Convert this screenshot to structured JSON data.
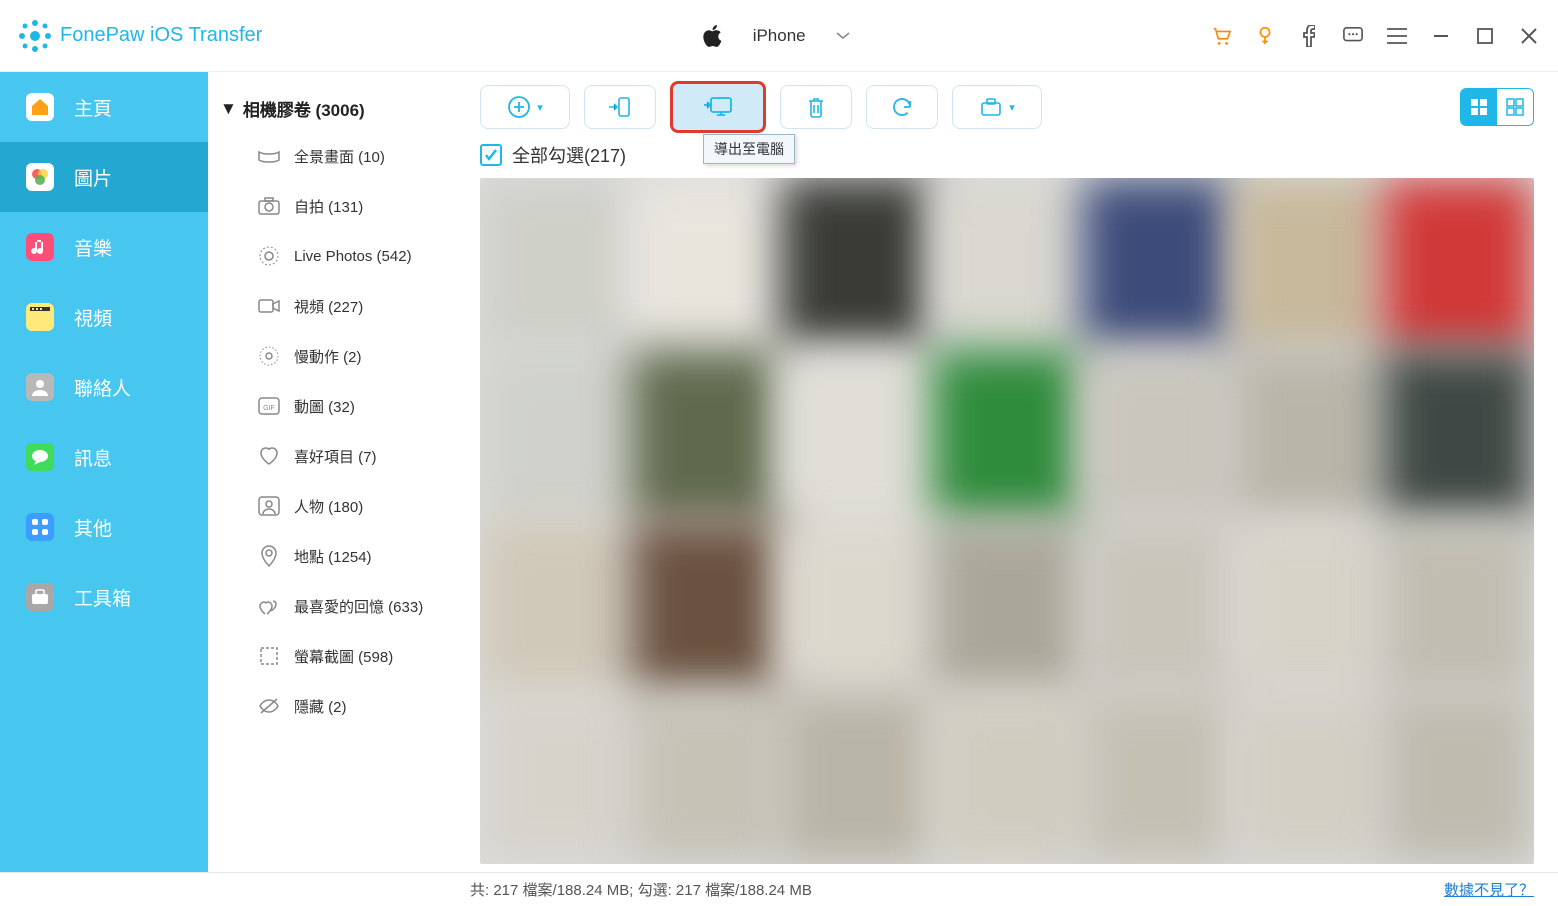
{
  "app": {
    "title": "FonePaw iOS Transfer"
  },
  "device": {
    "name": "iPhone"
  },
  "nav": [
    {
      "label": "主頁"
    },
    {
      "label": "圖片"
    },
    {
      "label": "音樂"
    },
    {
      "label": "視頻"
    },
    {
      "label": "聯絡人"
    },
    {
      "label": "訊息"
    },
    {
      "label": "其他"
    },
    {
      "label": "工具箱"
    }
  ],
  "albums": {
    "header": "相機膠卷 (3006)",
    "items": [
      {
        "label": "全景畫面 (10)"
      },
      {
        "label": "自拍 (131)"
      },
      {
        "label": "Live Photos (542)"
      },
      {
        "label": "視頻 (227)"
      },
      {
        "label": "慢動作 (2)"
      },
      {
        "label": "動圖 (32)"
      },
      {
        "label": "喜好項目 (7)"
      },
      {
        "label": "人物 (180)"
      },
      {
        "label": "地點 (1254)"
      },
      {
        "label": "最喜愛的回憶 (633)"
      },
      {
        "label": "螢幕截圖 (598)"
      },
      {
        "label": "隱藏 (2)"
      }
    ]
  },
  "toolbar": {
    "export_tooltip": "導出至電腦"
  },
  "select": {
    "label": "全部勾選(217)"
  },
  "status": {
    "text": "共: 217 檔案/188.24 MB; 勾選: 217 檔案/188.24 MB",
    "link": "數據不見了？"
  }
}
